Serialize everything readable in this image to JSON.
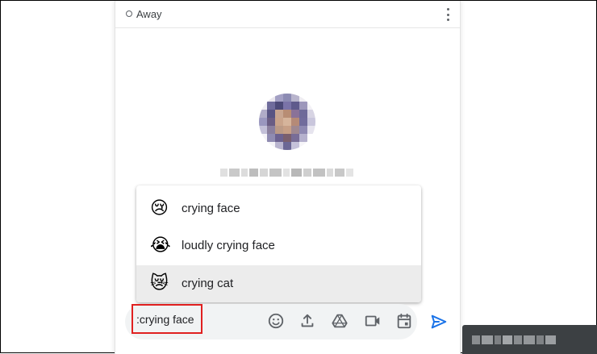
{
  "header": {
    "status_label": "Away",
    "menu_icon": "more-vert-icon"
  },
  "suggestions": [
    {
      "emoji": "😢",
      "label": "crying face",
      "selected": false
    },
    {
      "emoji": "😭",
      "label": "loudly crying face",
      "selected": false
    },
    {
      "emoji": "😿",
      "label": "crying cat",
      "selected": true
    }
  ],
  "compose": {
    "value": ":crying face",
    "tools": [
      "emoji-icon",
      "upload-icon",
      "drive-icon",
      "video-icon",
      "calendar-icon"
    ],
    "send_icon": "send-icon"
  },
  "colors": {
    "highlight_border": "#e02020",
    "send_blue": "#1a73e8",
    "selected_row": "#ececec",
    "icon_gray": "#5f6368"
  }
}
